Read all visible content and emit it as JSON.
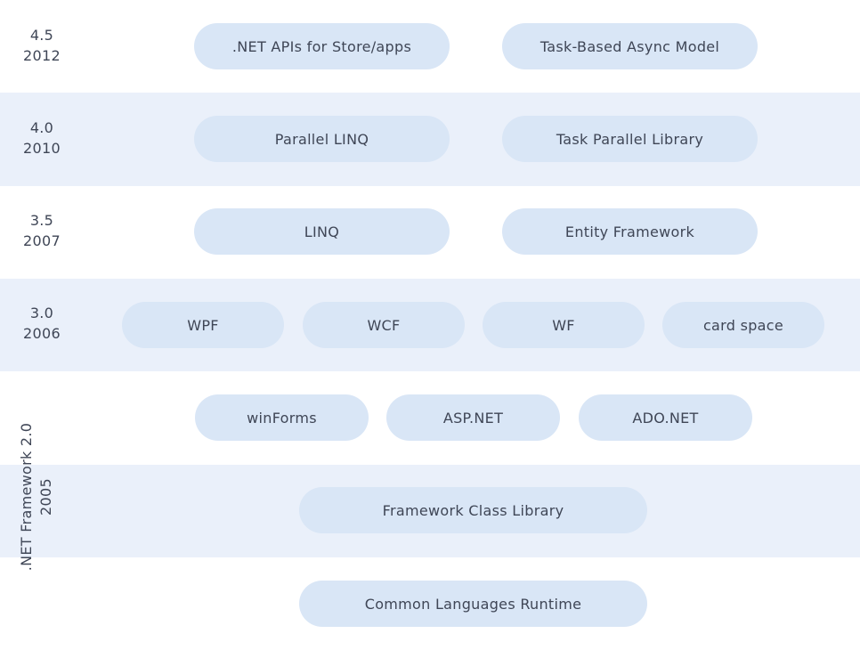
{
  "rows": [
    {
      "version": "4.5",
      "year": "2012",
      "items": [
        ".NET APIs for Store/apps",
        "Task-Based Async Model"
      ]
    },
    {
      "version": "4.0",
      "year": "2010",
      "items": [
        "Parallel LINQ",
        "Task Parallel Library"
      ]
    },
    {
      "version": "3.5",
      "year": "2007",
      "items": [
        "LINQ",
        "Entity Framework"
      ]
    },
    {
      "version": "3.0",
      "year": "2006",
      "items": [
        "WPF",
        "WCF",
        "WF",
        "card space"
      ]
    }
  ],
  "base": {
    "label": ".NET Framework 2.0",
    "year": "2005",
    "layer1": [
      "winForms",
      "ASP.NET",
      "ADO.NET"
    ],
    "layer2": "Framework Class Library",
    "layer3": "Common Languages Runtime"
  },
  "colors": {
    "band_tint": "#eaf0fa",
    "pill_fill": "#d9e6f6",
    "text": "#3f4656"
  }
}
